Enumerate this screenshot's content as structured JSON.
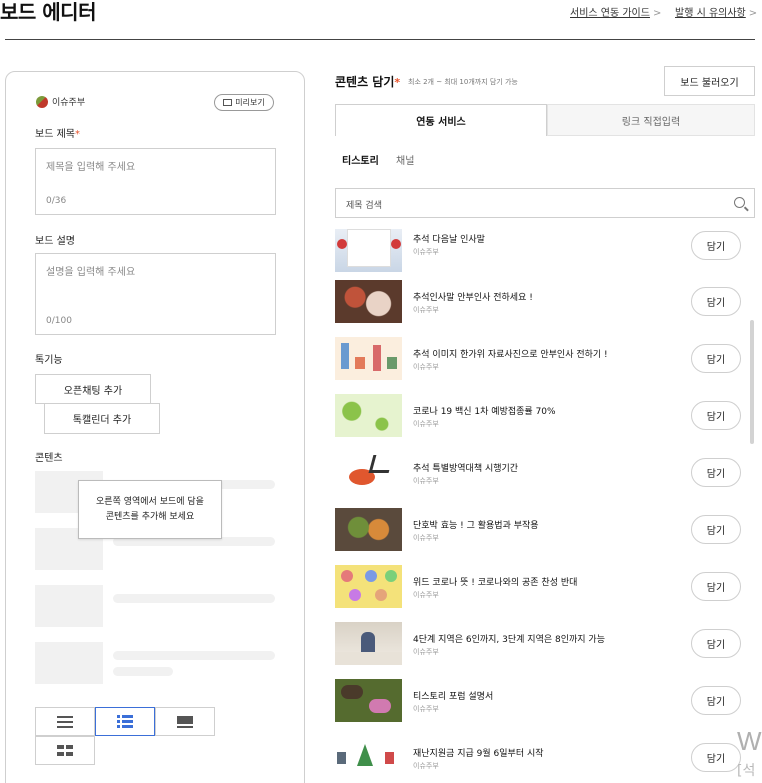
{
  "header": {
    "title": "보드 에디터",
    "links": [
      {
        "label": "서비스 연동 가이드"
      },
      {
        "label": "발행 시 유의사항"
      }
    ],
    "chevron": ">"
  },
  "left": {
    "owner": "이슈주부",
    "preview_label": "미리보기",
    "title_label": "보드 제목",
    "required_mark": "*",
    "title_placeholder": "제목을 입력해 주세요",
    "title_count": "0/36",
    "desc_label": "보드 설명",
    "desc_placeholder": "설명을 입력해 주세요",
    "desc_count": "0/100",
    "feature_label": "톡기능",
    "openchat_btn": "오픈채팅 추가",
    "calendar_btn": "톡캘린더 추가",
    "contents_label": "콘텐츠",
    "tooltip_line1": "오른쪽 영역에서 보드에 담을",
    "tooltip_line2": "콘텐츠를 추가해 보세요",
    "view_modes": [
      "list-view",
      "card-list-view",
      "large-card-view",
      "grid-view"
    ],
    "selected_view": "card-list-view"
  },
  "right": {
    "title": "콘텐츠 담기",
    "required_mark": "*",
    "subtitle": "최소 2개 ~ 최대 10개까지 담기 가능",
    "load_btn": "보드 불러오기",
    "tabs": [
      {
        "label": "연동 서비스",
        "active": true
      },
      {
        "label": "링크 직접입력",
        "active": false
      }
    ],
    "subtabs": [
      {
        "label": "티스토리",
        "active": true
      },
      {
        "label": "채널",
        "active": false
      }
    ],
    "search_placeholder": "제목 검색",
    "add_label": "담기",
    "items": [
      {
        "title": "추석 다음날 인사말",
        "owner": "이슈주부"
      },
      {
        "title": "추석인사말 안부인사 전하세요 !",
        "owner": "이슈주부"
      },
      {
        "title": "추석 이미지 한가위 자료사진으로 안부인사 전하기 !",
        "owner": "이슈주부"
      },
      {
        "title": "코로나 19 백신 1차 예방접종률 70%",
        "owner": "이슈주부"
      },
      {
        "title": "추석 특별방역대책 시행기간",
        "owner": "이슈주부"
      },
      {
        "title": "단호박 효능 ! 그 활용법과 부작용",
        "owner": "이슈주부"
      },
      {
        "title": "위드 코로나 뜻 ! 코로나와의 공존 찬성 반대",
        "owner": "이슈주부"
      },
      {
        "title": "4단계 지역은 6인까지, 3단계 지역은 8인까지 가능",
        "owner": "이슈주부"
      },
      {
        "title": "티스토리 포럼 설명서",
        "owner": "이슈주부"
      },
      {
        "title": "재난지원금 지급 9월 6일부터 시작",
        "owner": "이슈주부"
      }
    ]
  },
  "watermark": {
    "big": "W",
    "small": "[석"
  }
}
